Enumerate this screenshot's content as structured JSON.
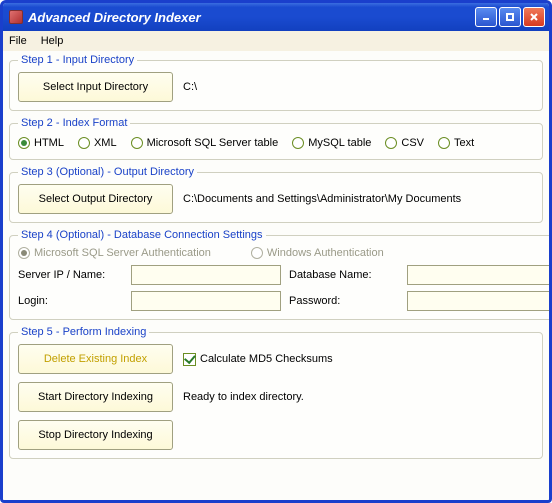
{
  "window": {
    "title": "Advanced Directory Indexer"
  },
  "menu": {
    "file": "File",
    "help": "Help"
  },
  "step1": {
    "legend": "Step 1 - Input Directory",
    "button": "Select Input Directory",
    "path": "C:\\"
  },
  "step2": {
    "legend": "Step 2 - Index Format",
    "options": {
      "html": "HTML",
      "xml": "XML",
      "mssql": "Microsoft SQL Server table",
      "mysql": "MySQL table",
      "csv": "CSV",
      "text": "Text"
    },
    "selected": "html"
  },
  "step3": {
    "legend": "Step 3 (Optional) - Output Directory",
    "button": "Select Output Directory",
    "path": "C:\\Documents and Settings\\Administrator\\My Documents"
  },
  "step4": {
    "legend": "Step 4 (Optional) - Database Connection Settings",
    "auth_sql": "Microsoft SQL Server Authentication",
    "auth_win": "Windows Authentication",
    "labels": {
      "server": "Server IP / Name:",
      "database": "Database Name:",
      "login": "Login:",
      "password": "Password:"
    },
    "values": {
      "server": "",
      "database": "",
      "login": "",
      "password": ""
    }
  },
  "step5": {
    "legend": "Step 5 - Perform Indexing",
    "delete_button": "Delete Existing Index",
    "md5_label": "Calculate MD5 Checksums",
    "md5_checked": true,
    "start_button": "Start Directory Indexing",
    "status": "Ready to index directory.",
    "stop_button": "Stop Directory Indexing"
  }
}
